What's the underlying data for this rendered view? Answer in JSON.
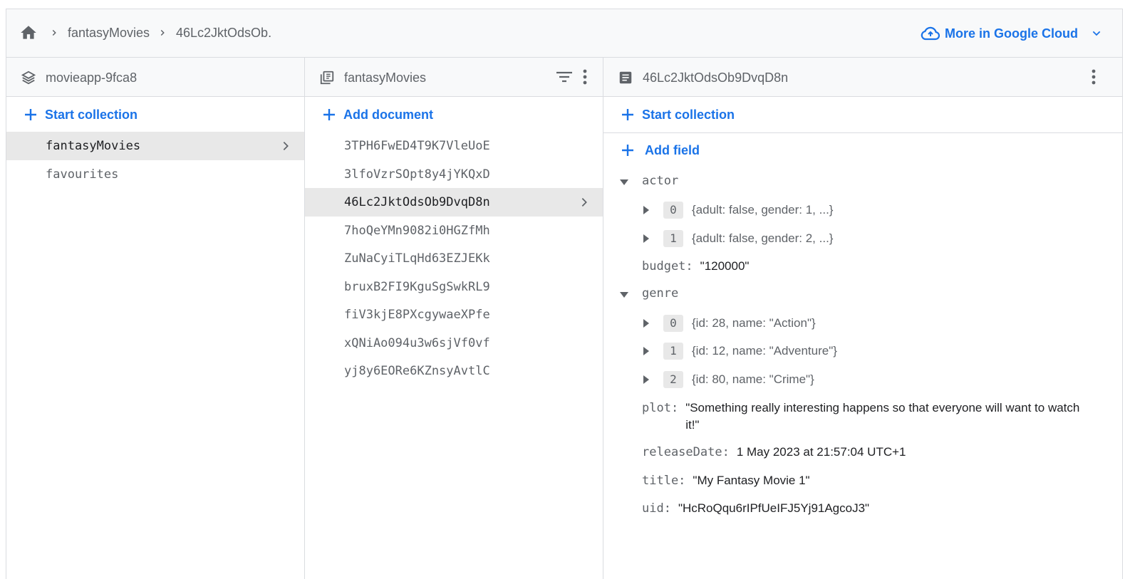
{
  "breadcrumb": {
    "home_icon": "home-icon",
    "items": [
      "fantasyMovies",
      "46Lc2JktOdsOb."
    ]
  },
  "cloud_link": {
    "label": "More in Google Cloud",
    "color": "#1a73e8"
  },
  "columns": {
    "project": {
      "title": "movieapp-9fca8",
      "action": "Start collection",
      "items": [
        "fantasyMovies",
        "favourites"
      ],
      "selected_index": 0
    },
    "collection": {
      "title": "fantasyMovies",
      "action": "Add document",
      "items": [
        "3TPH6FwED4T9K7VleUoE",
        "3lfoVzrSOpt8y4jYKQxD",
        "46Lc2JktOdsOb9DvqD8n",
        "7hoQeYMn9082i0HGZfMh",
        "ZuNaCyiTLqHd63EZJEKk",
        "bruxB2FI9KguSgSwkRL9",
        "fiV3kjE8PXcgywaeXPfe",
        "xQNiAo094u3w6sjVf0vf",
        "yj8y6EORe6KZnsyAvtlC"
      ],
      "selected_index": 2
    },
    "document": {
      "title": "46Lc2JktOdsOb9DvqD8n",
      "start_collection": "Start collection",
      "add_field": "Add field",
      "fields": {
        "actor": {
          "key": "actor",
          "items": [
            {
              "index": "0",
              "value": "{adult: false, gender: 1, ...}"
            },
            {
              "index": "1",
              "value": "{adult: false, gender: 2, ...}"
            }
          ]
        },
        "budget": {
          "key": "budget:",
          "value": "\"120000\""
        },
        "genre": {
          "key": "genre",
          "items": [
            {
              "index": "0",
              "value": "{id: 28, name: \"Action\"}"
            },
            {
              "index": "1",
              "value": "{id: 12, name: \"Adventure\"}"
            },
            {
              "index": "2",
              "value": "{id: 80, name: \"Crime\"}"
            }
          ]
        },
        "plot": {
          "key": "plot:",
          "value": "\"Something really interesting happens so that everyone will want to watch it!\""
        },
        "releaseDate": {
          "key": "releaseDate:",
          "value": "1 May 2023 at 21:57:04 UTC+1"
        },
        "title": {
          "key": "title:",
          "value": "\"My Fantasy Movie 1\""
        },
        "uid": {
          "key": "uid:",
          "value": "\"HcRoQqu6rIPfUeIFJ5Yj91AgcoJ3\""
        }
      }
    }
  }
}
